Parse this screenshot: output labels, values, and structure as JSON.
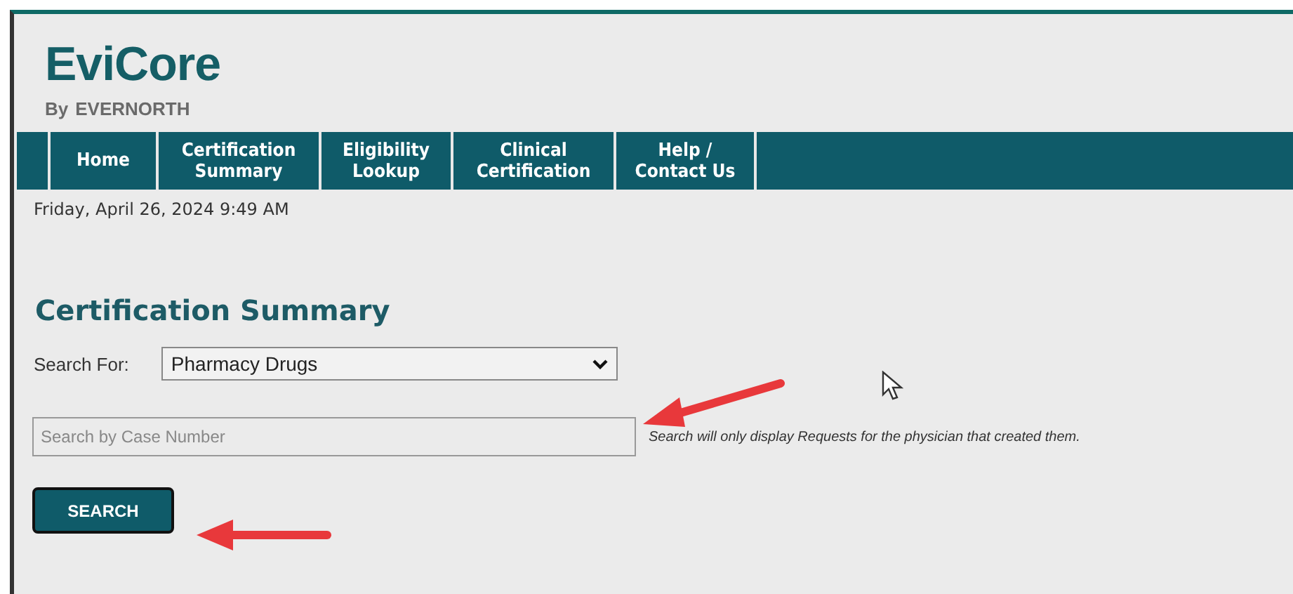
{
  "logo": {
    "name": "EviCore",
    "tagline_prefix": "By",
    "tagline_brand": "EVERNORTH"
  },
  "nav": [
    {
      "label": "Home"
    },
    {
      "label": "Certification Summary"
    },
    {
      "label": "Eligibility Lookup"
    },
    {
      "label": "Clinical Certification"
    },
    {
      "label": "Help / Contact Us"
    }
  ],
  "datetime": "Friday, April 26, 2024 9:49 AM",
  "heading": "Certification Summary",
  "search_for": {
    "label": "Search For:",
    "value": "Pharmacy Drugs"
  },
  "case_search": {
    "placeholder": "Search by Case Number",
    "note": "Search will only display Requests for the physician that created them."
  },
  "button": "SEARCH"
}
